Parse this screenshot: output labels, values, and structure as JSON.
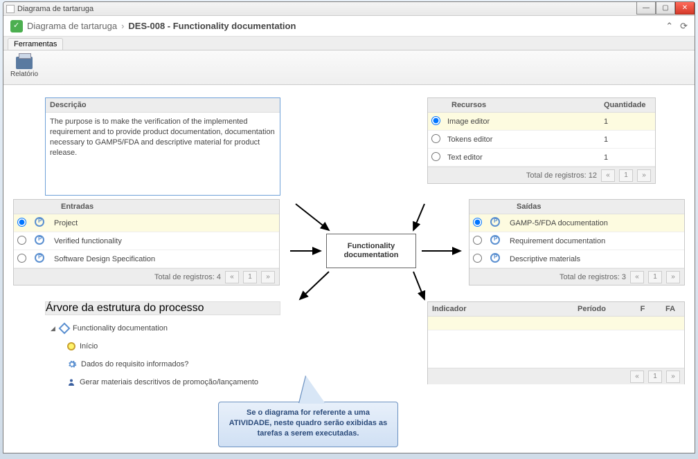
{
  "window": {
    "title": "Diagrama de tartaruga"
  },
  "breadcrumb": {
    "app": "Diagrama de tartaruga",
    "title": "DES-008 - Functionality documentation"
  },
  "tabs": {
    "tool": "Ferramentas"
  },
  "toolbar": {
    "report": "Relatório"
  },
  "desc": {
    "header": "Descrição",
    "body": "The purpose is to make the verification of the implemented requirement and to provide product documentation, documentation necessary to GAMP5/FDA and descriptive material for product release."
  },
  "recursos": {
    "col1": "Recursos",
    "col2": "Quantidade",
    "rows": [
      {
        "name": "Image editor",
        "qty": "1"
      },
      {
        "name": "Tokens editor",
        "qty": "1"
      },
      {
        "name": "Text editor",
        "qty": "1"
      }
    ],
    "total": "Total de registros: 12"
  },
  "entradas": {
    "header": "Entradas",
    "rows": [
      {
        "name": "Project"
      },
      {
        "name": "Verified functionality"
      },
      {
        "name": "Software Design Specification"
      }
    ],
    "total": "Total de registros: 4"
  },
  "saidas": {
    "header": "Saídas",
    "rows": [
      {
        "name": "GAMP-5/FDA documentation"
      },
      {
        "name": "Requirement documentation"
      },
      {
        "name": "Descriptive materials"
      }
    ],
    "total": "Total de registros: 3"
  },
  "indicador": {
    "col1": "Indicador",
    "col2": "Período",
    "col3": "F",
    "col4": "FA"
  },
  "center": {
    "label": "Functionality documentation"
  },
  "tree": {
    "header": "Árvore da estrutura do processo",
    "root": "Functionality documentation",
    "items": [
      "Início",
      "Dados do requisito informados?",
      "Gerar materiais descritivos de promoção/lançamento"
    ]
  },
  "callout": {
    "text": "Se o diagrama for referente a uma ATIVIDADE, neste quadro serão exibidas as tarefas a serem executadas."
  },
  "pager": {
    "page": "1"
  }
}
